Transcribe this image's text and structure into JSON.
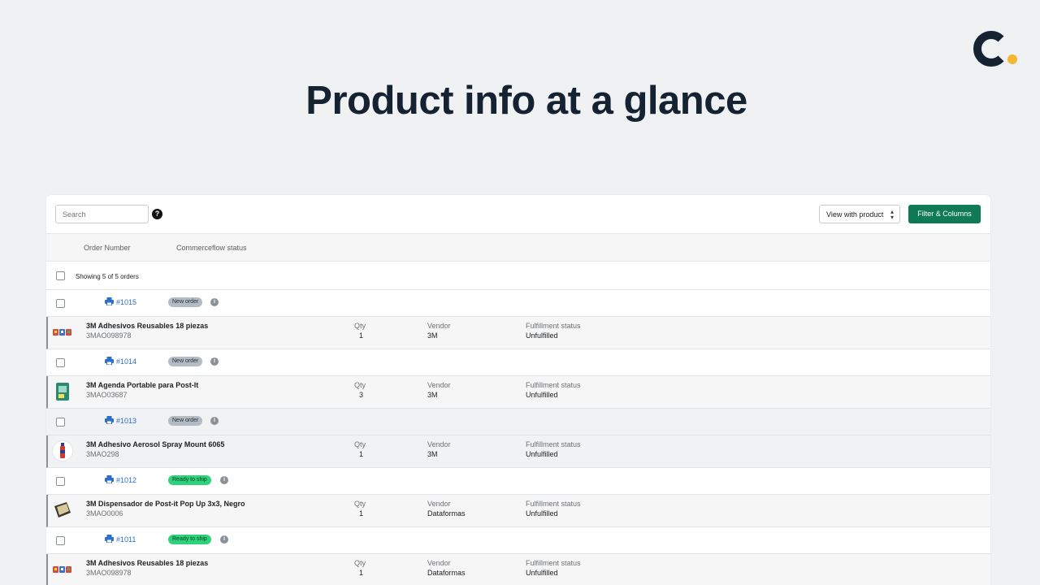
{
  "brand": {
    "accent": "#f5b731",
    "navy": "#152232"
  },
  "hero": {
    "title": "Product info at a glance"
  },
  "toolbar": {
    "search_placeholder": "Search",
    "help_glyph": "?",
    "view_select": "View with product",
    "filter_button": "Filter & Columns"
  },
  "columns": {
    "order_number": "Order Number",
    "status": "Commerceflow status"
  },
  "showing": "Showing 5 of 5 orders",
  "orders": [
    {
      "number": "#1015",
      "status": "New order",
      "status_type": "new",
      "product": {
        "name": "3M Adhesivos Reusables 18 piezas",
        "sku": "3MAO098978",
        "qty_label": "Qty",
        "qty": "1",
        "vendor_label": "Vendor",
        "vendor": "3M",
        "fulfillment_label": "Fulfillment status",
        "fulfillment": "Unfulfilled",
        "thumb": "stickers-icon"
      }
    },
    {
      "number": "#1014",
      "status": "New order",
      "status_type": "new",
      "product": {
        "name": "3M Agenda Portable para Post-It",
        "sku": "3MAO03687",
        "qty_label": "Qty",
        "qty": "3",
        "vendor_label": "Vendor",
        "vendor": "3M",
        "fulfillment_label": "Fulfillment status",
        "fulfillment": "Unfulfilled",
        "thumb": "agenda-icon"
      }
    },
    {
      "number": "#1013",
      "status": "New order",
      "status_type": "new",
      "product": {
        "name": "3M Adhesivo Aerosol Spray Mount 6065",
        "sku": "3MAO298",
        "qty_label": "Qty",
        "qty": "1",
        "vendor_label": "Vendor",
        "vendor": "3M",
        "fulfillment_label": "Fulfillment status",
        "fulfillment": "Unfulfilled",
        "thumb": "spray-can-icon"
      }
    },
    {
      "number": "#1012",
      "status": "Ready to ship",
      "status_type": "ready",
      "product": {
        "name": "3M Dispensador de Post-it Pop Up 3x3, Negro",
        "sku": "3MAO0006",
        "qty_label": "Qty",
        "qty": "1",
        "vendor_label": "Vendor",
        "vendor": "Dataformas",
        "fulfillment_label": "Fulfillment status",
        "fulfillment": "Unfulfilled",
        "thumb": "dispenser-icon"
      }
    },
    {
      "number": "#1011",
      "status": "Ready to ship",
      "status_type": "ready",
      "product": {
        "name": "3M Adhesivos Reusables 18 piezas",
        "sku": "3MAO098978",
        "qty_label": "Qty",
        "qty": "1",
        "vendor_label": "Vendor",
        "vendor": "Dataformas",
        "fulfillment_label": "Fulfillment status",
        "fulfillment": "Unfulfilled",
        "thumb": "stickers-icon"
      }
    }
  ]
}
